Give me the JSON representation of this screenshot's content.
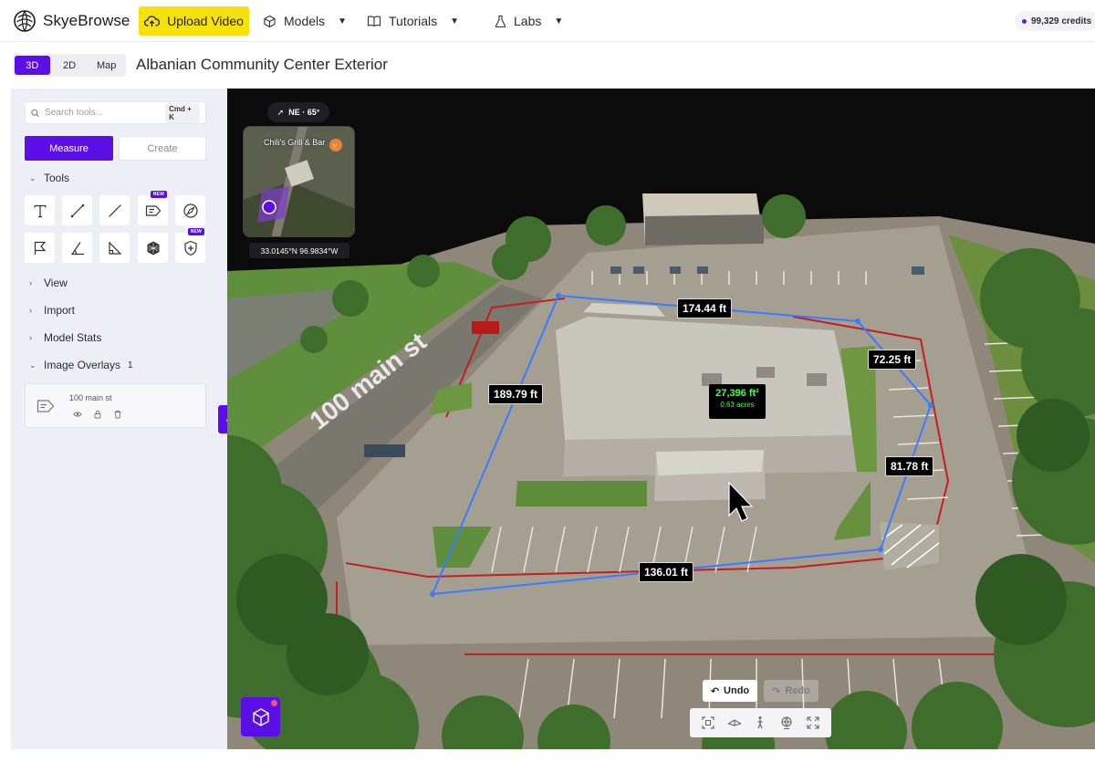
{
  "app": {
    "brand": "SkyeBrowse",
    "upload_label": "Upload Video",
    "nav": [
      {
        "label": "Models"
      },
      {
        "label": "Tutorials"
      },
      {
        "label": "Labs"
      }
    ],
    "credits": "99,329 credits"
  },
  "view_tabs": [
    "3D",
    "2D",
    "Map"
  ],
  "active_view": "3D",
  "page_title": "Albanian Community Center Exterior",
  "sidebar": {
    "search_placeholder": "Search tools...",
    "search_shortcut": "Cmd + K",
    "mode_tabs": [
      "Measure",
      "Create"
    ],
    "sections": {
      "tools": "Tools",
      "view": "View",
      "import": "Import",
      "model_stats": "Model Stats",
      "image_overlays": "Image Overlays",
      "image_overlays_count": "1"
    },
    "tool_badges": [
      "NEW",
      "NEW"
    ],
    "overlay_item": "100 main st"
  },
  "viewport": {
    "compass": "NE · 65°",
    "minimap_place": "Chili's Grill & Bar",
    "coordinates": "33.0145°N 96.9834°W",
    "street_label": "100 main st",
    "measurements": [
      "174.44 ft",
      "72.25 ft",
      "189.79 ft",
      "81.78 ft",
      "136.01 ft"
    ],
    "area": {
      "value": "27,396 ft²",
      "acres": "0.63 acres"
    },
    "undo_label": "Undo",
    "redo_label": "Redo"
  },
  "colors": {
    "accent": "#5b0fe6",
    "upload": "#f5e10b",
    "measure_line": "#3a7bff",
    "boundary": "#d81b1b",
    "area_text": "#4dff4d"
  }
}
